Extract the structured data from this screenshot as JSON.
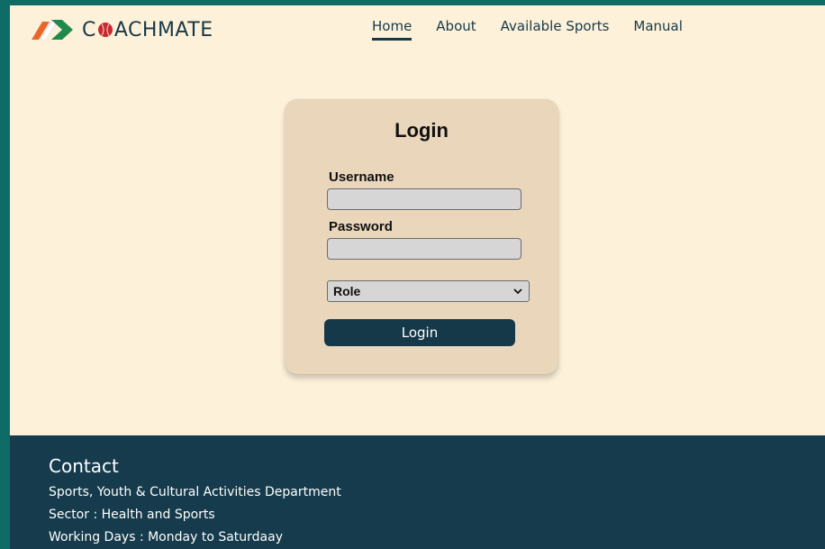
{
  "brand": {
    "name_prefix": "C",
    "name_suffix": "ACHMATE"
  },
  "nav": {
    "items": [
      {
        "label": "Home",
        "active": true
      },
      {
        "label": "About",
        "active": false
      },
      {
        "label": "Available Sports",
        "active": false
      },
      {
        "label": "Manual",
        "active": false
      }
    ]
  },
  "login": {
    "title": "Login",
    "username_label": "Username",
    "username_value": "",
    "password_label": "Password",
    "password_value": "",
    "role_selected": "Role",
    "button_label": "Login"
  },
  "footer": {
    "title": "Contact",
    "lines": [
      "Sports, Youth & Cultural Activities Department",
      "Sector : Health and Sports",
      "Working Days : Monday to Saturdaay"
    ]
  },
  "colors": {
    "frame": "#0f6b66",
    "page_bg": "#fdf1d9",
    "card_bg": "#e9d6bb",
    "primary": "#16394a",
    "logo_orange": "#e9662b",
    "logo_green": "#1f8a4c",
    "ball_red": "#c8292e"
  }
}
